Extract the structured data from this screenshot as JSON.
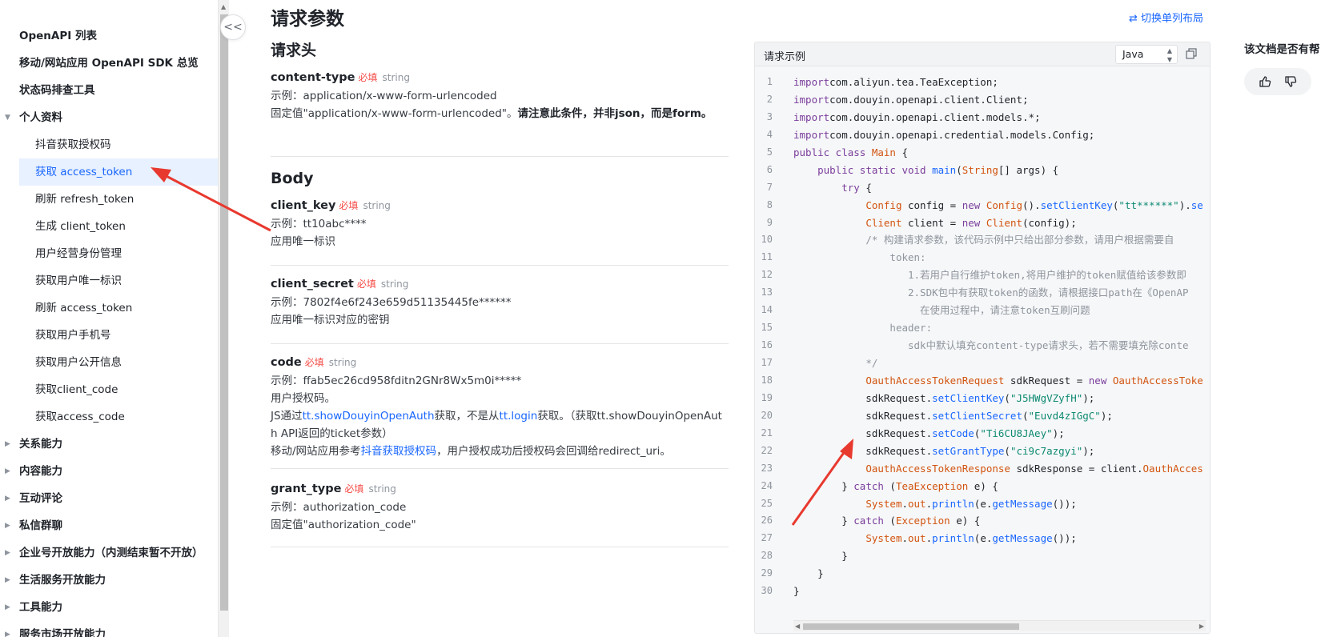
{
  "sidebar": {
    "items": [
      {
        "label": "OpenAPI 列表",
        "level": "top"
      },
      {
        "label": "移动/网站应用 OpenAPI SDK 总览",
        "level": "top"
      },
      {
        "label": "状态码排查工具",
        "level": "top"
      },
      {
        "label": "个人资料",
        "level": "top-open"
      },
      {
        "label": "抖音获取授权码",
        "level": "child"
      },
      {
        "label": "获取 access_token",
        "level": "child-active"
      },
      {
        "label": "刷新 refresh_token",
        "level": "child"
      },
      {
        "label": "生成 client_token",
        "level": "child"
      },
      {
        "label": "用户经营身份管理",
        "level": "child"
      },
      {
        "label": "获取用户唯一标识",
        "level": "child"
      },
      {
        "label": "刷新 access_token",
        "level": "child"
      },
      {
        "label": "获取用户手机号",
        "level": "child"
      },
      {
        "label": "获取用户公开信息",
        "level": "child"
      },
      {
        "label": "获取client_code",
        "level": "child"
      },
      {
        "label": "获取access_code",
        "level": "child"
      },
      {
        "label": "关系能力",
        "level": "top-closed"
      },
      {
        "label": "内容能力",
        "level": "top-closed"
      },
      {
        "label": "互动评论",
        "level": "top-closed"
      },
      {
        "label": "私信群聊",
        "level": "top-closed"
      },
      {
        "label": "企业号开放能力（内测结束暂不开放）",
        "level": "top-closed"
      },
      {
        "label": "生活服务开放能力",
        "level": "top-closed"
      },
      {
        "label": "工具能力",
        "level": "top-closed"
      },
      {
        "label": "服务市场开放能力",
        "level": "top-closed"
      }
    ],
    "collapse_glyph": "<<"
  },
  "main": {
    "title": "请求参数",
    "header_section": "请求头",
    "content_type": {
      "name": "content-type",
      "required": "必填",
      "type": "string",
      "example": "示例：application/x-www-form-urlencoded",
      "desc_plain": "固定值\"application/x-www-form-urlencoded\"。",
      "desc_bold": "请注意此条件，并非json，而是form。"
    },
    "body_section": "Body",
    "params": [
      {
        "name": "client_key",
        "required": "必填",
        "type": "string",
        "example": "示例：tt10abc****",
        "desc": "应用唯一标识"
      },
      {
        "name": "client_secret",
        "required": "必填",
        "type": "string",
        "example": "示例：7802f4e6f243e659d51135445fe******",
        "desc": "应用唯一标识对应的密钥"
      }
    ],
    "code_param": {
      "name": "code",
      "required": "必填",
      "type": "string",
      "example": "示例：ffab5ec26cd958fditn2GNr8Wx5m0i*****",
      "desc1": "用户授权码。",
      "desc2_a": "JS通过",
      "desc2_link1": "tt.showDouyinOpenAuth",
      "desc2_b": "获取，不是从",
      "desc2_link2": "tt.login",
      "desc2_c": "获取。（获取tt.showDouyinOpenAut",
      "desc2_d": "h API返回的ticket参数）",
      "desc3_a": "移动/网站应用参考",
      "desc3_link": "抖音获取授权码",
      "desc3_b": "，用户授权成功后授权码会回调给redirect_uri。"
    },
    "grant_type": {
      "name": "grant_type",
      "required": "必填",
      "type": "string",
      "example": "示例：authorization_code",
      "desc": "固定值\"authorization_code\""
    }
  },
  "code_panel": {
    "switch_layout": "⇄ 切换单列布局",
    "title": "请求示例",
    "language": "Java",
    "lines": [
      [
        [
          "kw",
          "import"
        ],
        [
          "",
          "com.aliyun.tea.TeaException;"
        ]
      ],
      [
        [
          "kw",
          "import"
        ],
        [
          "",
          "com.douyin.openapi.client.Client;"
        ]
      ],
      [
        [
          "kw",
          "import"
        ],
        [
          "",
          "com.douyin.openapi.client.models.*;"
        ]
      ],
      [
        [
          "kw",
          "import"
        ],
        [
          "",
          "com.douyin.openapi.credential.models.Config;"
        ]
      ],
      [
        [
          "kw",
          "public class "
        ],
        [
          "ty",
          "Main"
        ],
        [
          "",
          " {"
        ]
      ],
      [
        [
          "",
          "    "
        ],
        [
          "kw",
          "public static void "
        ],
        [
          "fn",
          "main"
        ],
        [
          "",
          "("
        ],
        [
          "ty",
          "String"
        ],
        [
          "",
          "[] args) {"
        ]
      ],
      [
        [
          "",
          "        "
        ],
        [
          "kw",
          "try"
        ],
        [
          "",
          " {"
        ]
      ],
      [
        [
          "",
          "            "
        ],
        [
          "ty",
          "Config"
        ],
        [
          "",
          " config = "
        ],
        [
          "kw",
          "new "
        ],
        [
          "ty",
          "Config"
        ],
        [
          "",
          "()."
        ],
        [
          "fn",
          "setClientKey"
        ],
        [
          "",
          "("
        ],
        [
          "st",
          "\"tt******\""
        ],
        [
          "",
          ")."
        ],
        [
          "fn",
          "se"
        ]
      ],
      [
        [
          "",
          "            "
        ],
        [
          "ty",
          "Client"
        ],
        [
          "",
          " client = "
        ],
        [
          "kw",
          "new "
        ],
        [
          "ty",
          "Client"
        ],
        [
          "",
          "(config);"
        ]
      ],
      [
        [
          "",
          "            "
        ],
        [
          "cm",
          "/* 构建请求参数，该代码示例中只给出部分参数，请用户根据需要自"
        ]
      ],
      [
        [
          "",
          "                "
        ],
        [
          "cm",
          "token:"
        ]
      ],
      [
        [
          "",
          "                   "
        ],
        [
          "cm",
          "1.若用户自行维护token,将用户维护的token赋值给该参数即"
        ]
      ],
      [
        [
          "",
          "                   "
        ],
        [
          "cm",
          "2.SDK包中有获取token的函数，请根据接口path在《OpenAP"
        ]
      ],
      [
        [
          "",
          "                     "
        ],
        [
          "cm",
          "在使用过程中，请注意token互刷问题"
        ]
      ],
      [
        [
          "",
          "                "
        ],
        [
          "cm",
          "header:"
        ]
      ],
      [
        [
          "",
          "                   "
        ],
        [
          "cm",
          "sdk中默认填充content-type请求头，若不需要填充除conte"
        ]
      ],
      [
        [
          "",
          "            "
        ],
        [
          "cm",
          "*/"
        ]
      ],
      [
        [
          "",
          "            "
        ],
        [
          "ty",
          "OauthAccessTokenRequest"
        ],
        [
          "",
          " sdkRequest = "
        ],
        [
          "kw",
          "new "
        ],
        [
          "ty",
          "OauthAccessToke"
        ]
      ],
      [
        [
          "",
          "            sdkRequest."
        ],
        [
          "fn",
          "setClientKey"
        ],
        [
          "",
          "("
        ],
        [
          "st",
          "\"J5HWgVZyfH\""
        ],
        [
          "",
          ");"
        ]
      ],
      [
        [
          "",
          "            sdkRequest."
        ],
        [
          "fn",
          "setClientSecret"
        ],
        [
          "",
          "("
        ],
        [
          "st",
          "\"Euvd4zIGgC\""
        ],
        [
          "",
          ");"
        ]
      ],
      [
        [
          "",
          "            sdkRequest."
        ],
        [
          "fn",
          "setCode"
        ],
        [
          "",
          "("
        ],
        [
          "st",
          "\"Ti6CU8JAey\""
        ],
        [
          "",
          ");"
        ]
      ],
      [
        [
          "",
          "            sdkRequest."
        ],
        [
          "fn",
          "setGrantType"
        ],
        [
          "",
          "("
        ],
        [
          "st",
          "\"ci9c7azgyi\""
        ],
        [
          "",
          ");"
        ]
      ],
      [
        [
          "",
          "            "
        ],
        [
          "ty",
          "OauthAccessTokenResponse"
        ],
        [
          "",
          " sdkResponse = client."
        ],
        [
          "ty",
          "OauthAcces"
        ]
      ],
      [
        [
          "",
          "        } "
        ],
        [
          "kw",
          "catch"
        ],
        [
          "",
          " ("
        ],
        [
          "ty",
          "TeaException"
        ],
        [
          "",
          " e) {"
        ]
      ],
      [
        [
          "",
          "            "
        ],
        [
          "ty",
          "System"
        ],
        [
          "",
          "."
        ],
        [
          "ty",
          "out"
        ],
        [
          "",
          "."
        ],
        [
          "fn",
          "println"
        ],
        [
          "",
          "(e."
        ],
        [
          "fn",
          "getMessage"
        ],
        [
          "",
          "());"
        ]
      ],
      [
        [
          "",
          "        } "
        ],
        [
          "kw",
          "catch"
        ],
        [
          "",
          " ("
        ],
        [
          "ty",
          "Exception"
        ],
        [
          "",
          " e) {"
        ]
      ],
      [
        [
          "",
          "            "
        ],
        [
          "ty",
          "System"
        ],
        [
          "",
          "."
        ],
        [
          "ty",
          "out"
        ],
        [
          "",
          "."
        ],
        [
          "fn",
          "println"
        ],
        [
          "",
          "(e."
        ],
        [
          "fn",
          "getMessage"
        ],
        [
          "",
          "());"
        ]
      ],
      [
        [
          "",
          "        }"
        ]
      ],
      [
        [
          "",
          "    }"
        ]
      ],
      [
        [
          "",
          "}"
        ]
      ]
    ]
  },
  "feedback": {
    "title": "该文档是否有帮"
  },
  "colors": {
    "accent": "#1966ff",
    "required": "#f54a45",
    "annotation_arrow": "#e8392f",
    "active_bg": "#e8f1ff"
  }
}
